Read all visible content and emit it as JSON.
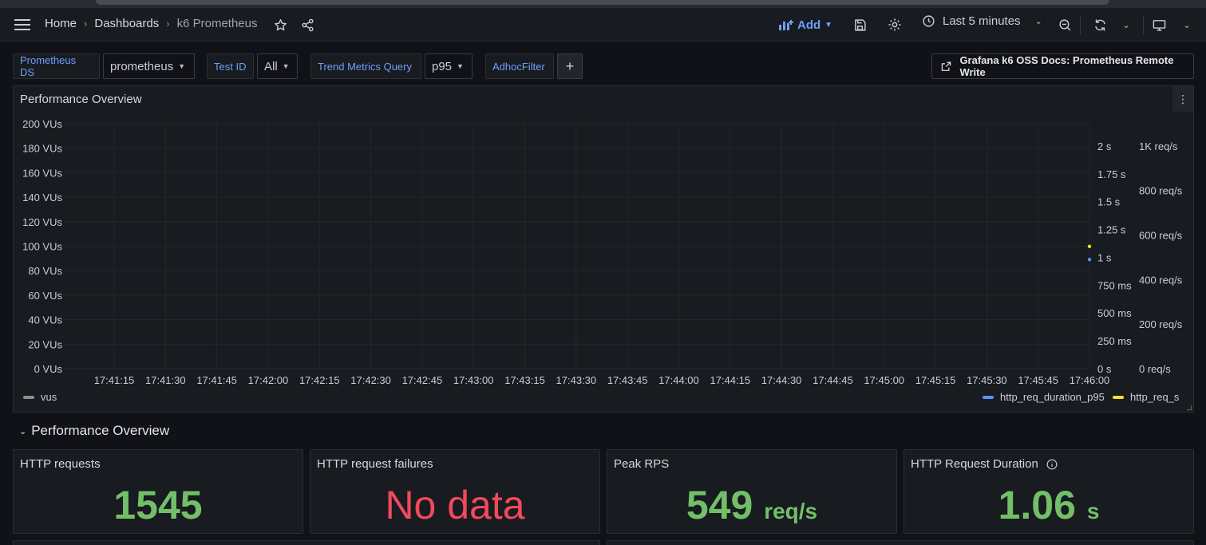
{
  "topbar": {
    "breadcrumbs": [
      "Home",
      "Dashboards",
      "k6 Prometheus"
    ],
    "add_label": "Add",
    "time_range": "Last 5 minutes"
  },
  "variables": [
    {
      "label": "Prometheus DS",
      "value": "prometheus"
    },
    {
      "label": "Test ID",
      "value": "All"
    },
    {
      "label": "Trend Metrics Query",
      "value": "p95"
    },
    {
      "label": "AdhocFilter",
      "value": ""
    }
  ],
  "doc_link": "Grafana k6 OSS Docs: Prometheus Remote Write",
  "timeseries_panel": {
    "title": "Performance Overview",
    "legend_left": "vus",
    "legend_right": [
      "http_req_duration_p95",
      "http_req_s"
    ]
  },
  "colors": {
    "vus": "#8e8e8e",
    "http_req_duration_p95": "#5794f2",
    "http_req_s": "#fade2a",
    "good": "#73bf69",
    "bad": "#f2495c"
  },
  "chart_data": {
    "type": "line",
    "title": "Performance Overview",
    "x": [
      "17:41:15",
      "17:41:30",
      "17:41:45",
      "17:42:00",
      "17:42:15",
      "17:42:30",
      "17:42:45",
      "17:43:00",
      "17:43:15",
      "17:43:30",
      "17:43:45",
      "17:44:00",
      "17:44:15",
      "17:44:30",
      "17:44:45",
      "17:45:00",
      "17:45:15",
      "17:45:30",
      "17:45:45",
      "17:46:00"
    ],
    "y_left_ticks": [
      "200 VUs",
      "180 VUs",
      "160 VUs",
      "140 VUs",
      "120 VUs",
      "100 VUs",
      "80 VUs",
      "60 VUs",
      "40 VUs",
      "20 VUs",
      "0 VUs"
    ],
    "y_right1_ticks": [
      "2 s",
      "1.75 s",
      "1.5 s",
      "1.25 s",
      "1 s",
      "750 ms",
      "500 ms",
      "250 ms",
      "0 s"
    ],
    "y_right2_ticks": [
      "1K req/s",
      "800 req/s",
      "600 req/s",
      "400 req/s",
      "200 req/s",
      "0 req/s"
    ],
    "ylim_left": [
      0,
      200
    ],
    "ylim_right1": [
      0,
      2.2
    ],
    "ylim_right2": [
      0,
      1100
    ],
    "grid": true,
    "series": [
      {
        "name": "vus",
        "axis": "left",
        "points": []
      },
      {
        "name": "http_req_duration_p95",
        "axis": "right1",
        "points": [
          {
            "x": "17:46:00",
            "y": 0.98
          }
        ]
      },
      {
        "name": "http_req_s",
        "axis": "right2",
        "points": [
          {
            "x": "17:46:00",
            "y": 549
          }
        ]
      }
    ]
  },
  "row": {
    "title": "Performance Overview"
  },
  "stats": [
    {
      "title": "HTTP requests",
      "value": "1545",
      "unit": "",
      "color": "green"
    },
    {
      "title": "HTTP request failures",
      "value": "No data",
      "unit": "",
      "color": "red"
    },
    {
      "title": "Peak RPS",
      "value": "549",
      "unit": "req/s",
      "color": "green"
    },
    {
      "title": "HTTP Request Duration",
      "value": "1.06",
      "unit": "s",
      "color": "green"
    }
  ]
}
